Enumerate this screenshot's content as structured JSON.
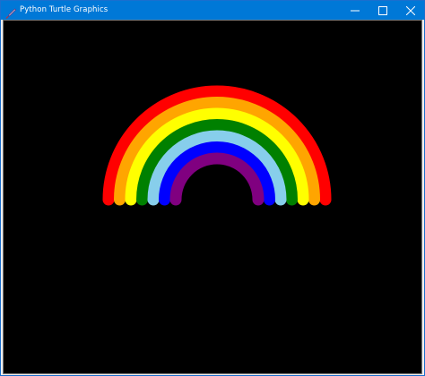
{
  "window": {
    "title": "Python Turtle Graphics",
    "icon": "feather-pen-icon",
    "controls": [
      "minimize-icon",
      "maximize-icon",
      "close-icon"
    ]
  },
  "canvas": {
    "background": "#000000",
    "rainbow": {
      "bands": [
        {
          "color": "red"
        },
        {
          "color": "orange"
        },
        {
          "color": "yellow"
        },
        {
          "color": "green"
        },
        {
          "color": "skyblue"
        },
        {
          "color": "blue"
        },
        {
          "color": "purple"
        }
      ]
    }
  },
  "colors": {
    "titlebar": "#0078d7",
    "titletext": "#ffffff"
  }
}
